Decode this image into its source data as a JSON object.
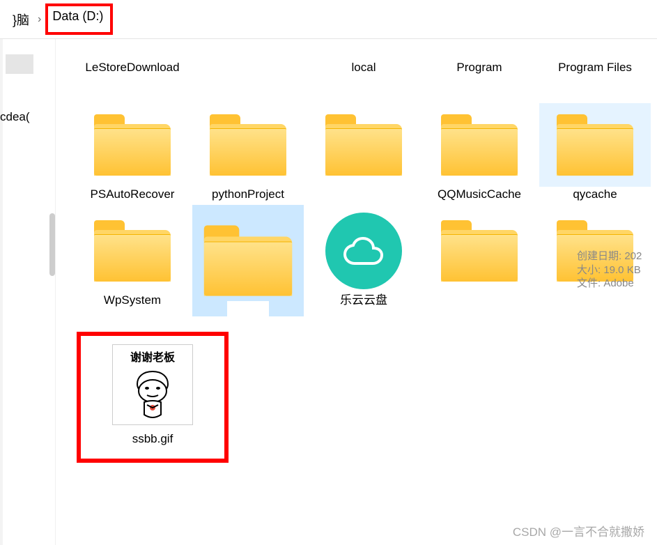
{
  "breadcrumb": {
    "part1": "}脑",
    "separator": "›",
    "current": "Data (D:)"
  },
  "sidebar": {
    "label": "cdea("
  },
  "items": [
    {
      "name": "LeStoreDownload",
      "type": "folder",
      "row": 1
    },
    {
      "name": "",
      "type": "folder",
      "row": 1
    },
    {
      "name": "local",
      "type": "folder",
      "row": 1
    },
    {
      "name": "Program",
      "type": "folder",
      "row": 1
    },
    {
      "name": "Program Files",
      "type": "folder",
      "row": 1
    },
    {
      "name": "PSAutoRecover",
      "type": "folder",
      "row": 2
    },
    {
      "name": "pythonProject",
      "type": "folder",
      "row": 2
    },
    {
      "name": "",
      "type": "folder",
      "row": 2
    },
    {
      "name": "QQMusicCache",
      "type": "folder",
      "row": 2
    },
    {
      "name": "qycache",
      "type": "folder",
      "row": 2,
      "hovered": true
    },
    {
      "name": "WpSystem",
      "type": "folder",
      "row": 3
    },
    {
      "name": "",
      "type": "folder",
      "row": 3,
      "selected": true
    },
    {
      "name": "乐云云盘",
      "type": "cloud",
      "row": 3
    },
    {
      "name": "",
      "type": "folder",
      "row": 3
    },
    {
      "name": "",
      "type": "folder",
      "row": 3
    }
  ],
  "tooltip": {
    "line1": "创建日期: 202",
    "line2": "大小: 19.0 KB",
    "line3": "文件: Adobe "
  },
  "file": {
    "thumb_caption": "谢谢老板",
    "label": "ssbb.gif"
  },
  "watermark": "CSDN @一言不合就撒娇"
}
